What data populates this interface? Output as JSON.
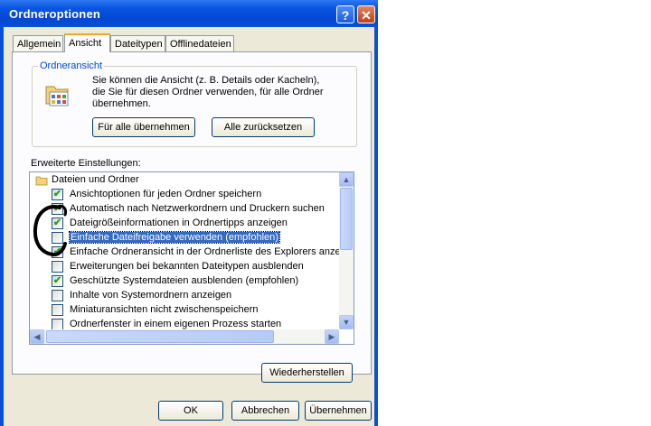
{
  "window": {
    "title": "Ordneroptionen",
    "help_glyph": "?",
    "close_glyph": "✕"
  },
  "tabs": [
    {
      "label": "Allgemein",
      "active": false
    },
    {
      "label": "Ansicht",
      "active": true
    },
    {
      "label": "Dateitypen",
      "active": false
    },
    {
      "label": "Offlinedateien",
      "active": false
    }
  ],
  "folder_view": {
    "group_title": "Ordneransicht",
    "description_lines": [
      "Sie können die Ansicht (z. B. Details oder Kacheln),",
      "die Sie für diesen Ordner verwenden, für alle Ordner",
      "übernehmen."
    ],
    "apply_all_label": "Für alle übernehmen",
    "reset_all_label": "Alle zurücksetzen"
  },
  "advanced": {
    "heading": "Erweiterte Einstellungen:",
    "folder_group": "Dateien und Ordner",
    "items": [
      {
        "label": "Ansichtoptionen für jeden Ordner speichern",
        "checked": true
      },
      {
        "label": "Automatisch nach Netzwerkordnern und Druckern suchen",
        "checked": true
      },
      {
        "label": "Dateigrößeinformationen in Ordnertipps anzeigen",
        "checked": true
      },
      {
        "label": "Einfache Dateifreigabe verwenden (empfohlen)",
        "checked": false,
        "selected": true
      },
      {
        "label": "Einfache Ordneransicht in der Ordnerliste des Explorers anzeigen",
        "checked": true
      },
      {
        "label": "Erweiterungen bei bekannten Dateitypen ausblenden",
        "checked": false
      },
      {
        "label": "Geschützte Systemdateien ausblenden (empfohlen)",
        "checked": true
      },
      {
        "label": "Inhalte von Systemordnern anzeigen",
        "checked": false
      },
      {
        "label": "Miniaturansichten nicht zwischenspeichern",
        "checked": false
      },
      {
        "label": "Ordnerfenster in einem eigenen Prozess starten",
        "checked": false
      }
    ],
    "restore_label": "Wiederherstellen"
  },
  "footer": {
    "ok_label": "OK",
    "cancel_label": "Abbrechen",
    "apply_label": "Übernehmen"
  },
  "scroll_glyphs": {
    "up": "▲",
    "down": "▼",
    "left": "◀",
    "right": "▶"
  },
  "colors": {
    "title_bar": "#0a4fd6",
    "selection": "#316ac5",
    "check": "#21a121",
    "annotation": "#000000"
  }
}
